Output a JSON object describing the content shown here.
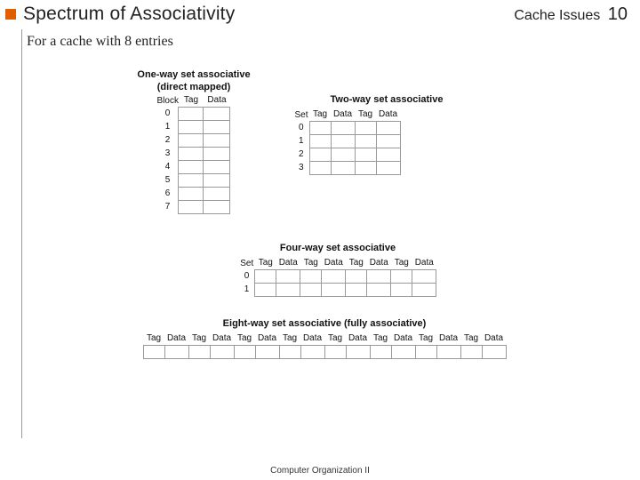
{
  "header": {
    "title": "Spectrum of Associativity",
    "right_label": "Cache Issues",
    "page_number": "10"
  },
  "subtitle": "For a cache with 8 entries",
  "footer": "Computer Organization II",
  "diagrams": {
    "one_way": {
      "title1": "One-way set associative",
      "title2": "(direct mapped)",
      "idx_label": "Block",
      "cols": [
        "Tag",
        "Data"
      ],
      "rows": [
        "0",
        "1",
        "2",
        "3",
        "4",
        "5",
        "6",
        "7"
      ]
    },
    "two_way": {
      "title": "Two-way set associative",
      "idx_label": "Set",
      "cols": [
        "Tag",
        "Data",
        "Tag",
        "Data"
      ],
      "rows": [
        "0",
        "1",
        "2",
        "3"
      ]
    },
    "four_way": {
      "title": "Four-way set associative",
      "idx_label": "Set",
      "cols": [
        "Tag",
        "Data",
        "Tag",
        "Data",
        "Tag",
        "Data",
        "Tag",
        "Data"
      ],
      "rows": [
        "0",
        "1"
      ]
    },
    "eight_way": {
      "title": "Eight-way set associative (fully associative)",
      "cols": [
        "Tag",
        "Data",
        "Tag",
        "Data",
        "Tag",
        "Data",
        "Tag",
        "Data",
        "Tag",
        "Data",
        "Tag",
        "Data",
        "Tag",
        "Data",
        "Tag",
        "Data"
      ]
    }
  }
}
